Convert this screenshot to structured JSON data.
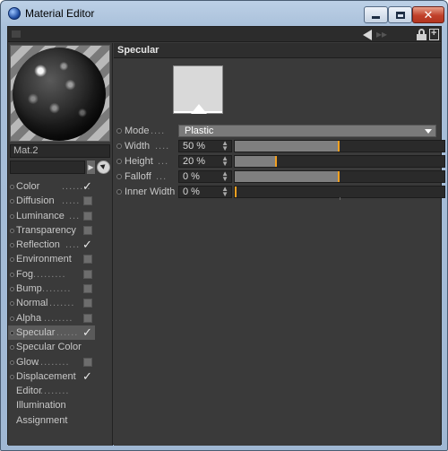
{
  "window": {
    "title": "Material Editor"
  },
  "material": {
    "name": "Mat.2",
    "name_field": ""
  },
  "channels": [
    {
      "label": "Color",
      "checked": true
    },
    {
      "label": "Diffusion",
      "checked": false
    },
    {
      "label": "Luminance",
      "checked": false
    },
    {
      "label": "Transparency",
      "checked": false
    },
    {
      "label": "Reflection",
      "checked": true
    },
    {
      "label": "Environment",
      "checked": false
    },
    {
      "label": "Fog",
      "checked": false
    },
    {
      "label": "Bump",
      "checked": false
    },
    {
      "label": "Normal",
      "checked": false
    },
    {
      "label": "Alpha",
      "checked": false
    },
    {
      "label": "Specular",
      "checked": true,
      "selected": true
    },
    {
      "label": "Specular Color",
      "checked": false
    },
    {
      "label": "Glow",
      "checked": false
    },
    {
      "label": "Displacement",
      "checked": true
    }
  ],
  "extra_pages": [
    "Editor",
    "Illumination",
    "Assignment"
  ],
  "section": {
    "title": "Specular"
  },
  "params": {
    "mode": {
      "label": "Mode",
      "value": "Plastic"
    },
    "width": {
      "label": "Width",
      "value": "50 %",
      "fraction": 0.5
    },
    "height": {
      "label": "Height",
      "value": "20 %",
      "fraction": 0.2
    },
    "falloff": {
      "label": "Falloff",
      "value": "0 %",
      "fraction": 0.5
    },
    "inner_width": {
      "label": "Inner Width",
      "value": "0 %",
      "fraction": 0.0
    }
  }
}
